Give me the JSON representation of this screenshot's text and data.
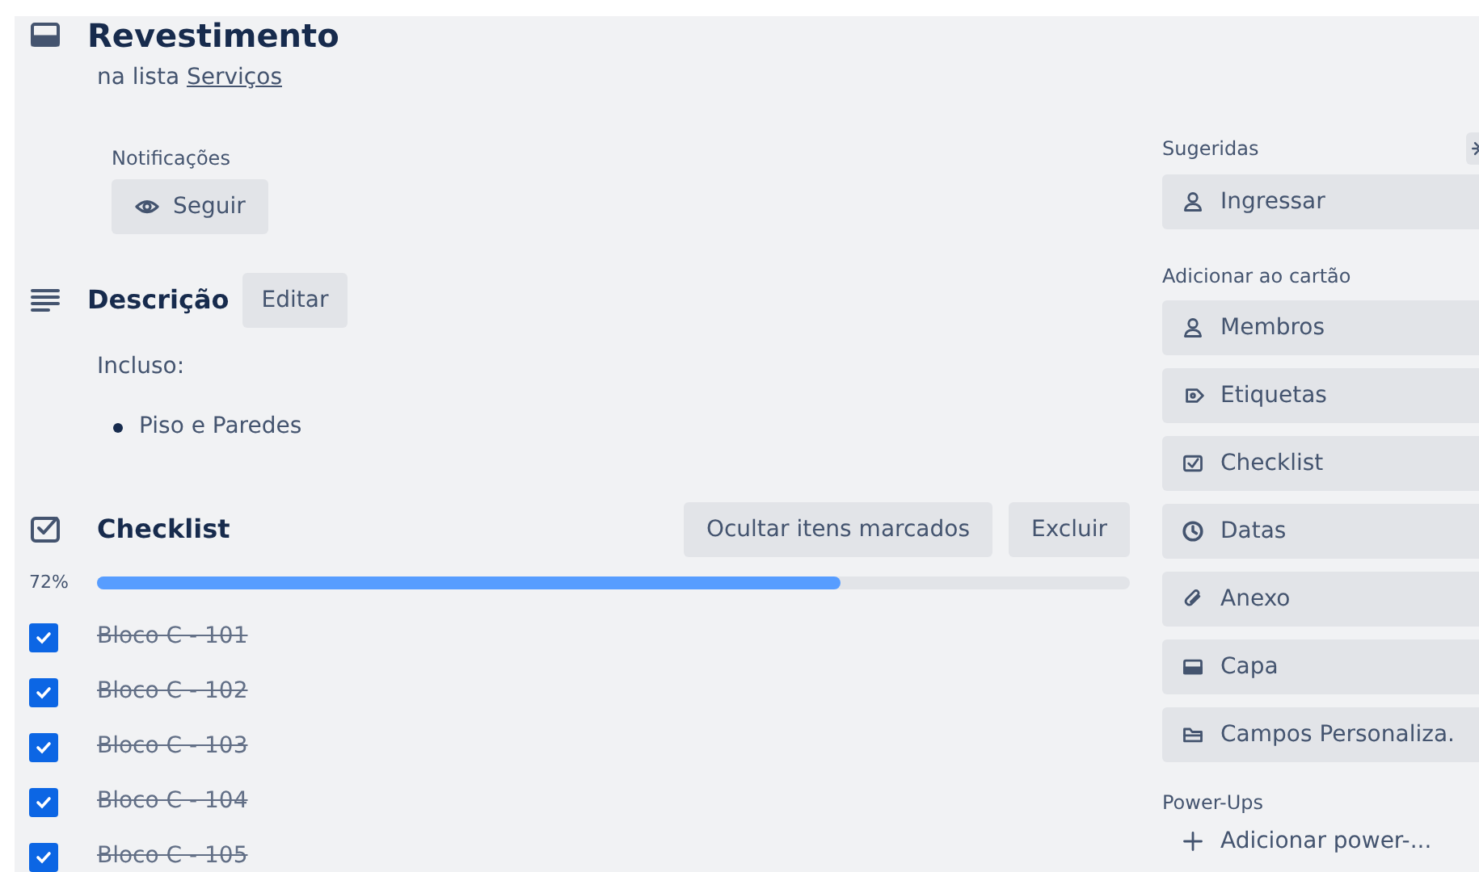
{
  "card": {
    "title": "Revestimento",
    "list_prefix": "na lista",
    "list_name": "Serviços"
  },
  "notifications": {
    "label": "Notificações",
    "button": "Seguir"
  },
  "description": {
    "title": "Descrição",
    "edit_button": "Editar",
    "text": "Incluso:",
    "bullets": [
      "Piso e Paredes"
    ]
  },
  "checklist": {
    "title": "Checklist",
    "buttons": [
      "Ocultar itens marcados",
      "Excluir"
    ],
    "percent": "72%",
    "level": 0.72,
    "items": [
      {
        "text": "Bloco C - 101",
        "checked": true
      },
      {
        "text": "Bloco C - 102",
        "checked": true
      },
      {
        "text": "Bloco C - 103",
        "checked": true
      },
      {
        "text": "Bloco C - 104",
        "checked": true
      },
      {
        "text": "Bloco C - 105",
        "checked": true
      }
    ]
  },
  "sidebar": {
    "sections": [
      {
        "title": "Sugeridas",
        "settings": true,
        "items": [
          {
            "kind": "person",
            "label": "Ingressar"
          }
        ]
      },
      {
        "title": "Adicionar ao cartão",
        "items": [
          {
            "kind": "person",
            "label": "Membros"
          },
          {
            "kind": "tag",
            "label": "Etiquetas"
          },
          {
            "kind": "checklist",
            "label": "Checklist"
          },
          {
            "kind": "clock",
            "label": "Datas"
          },
          {
            "kind": "clip",
            "label": "Anexo"
          },
          {
            "kind": "cover",
            "label": "Capa"
          },
          {
            "kind": "fields",
            "label": "Campos Personaliza."
          }
        ]
      },
      {
        "title": "Power-Ups",
        "items": [
          {
            "kind": "plus",
            "label": "Adicionar power-..."
          }
        ]
      }
    ]
  }
}
